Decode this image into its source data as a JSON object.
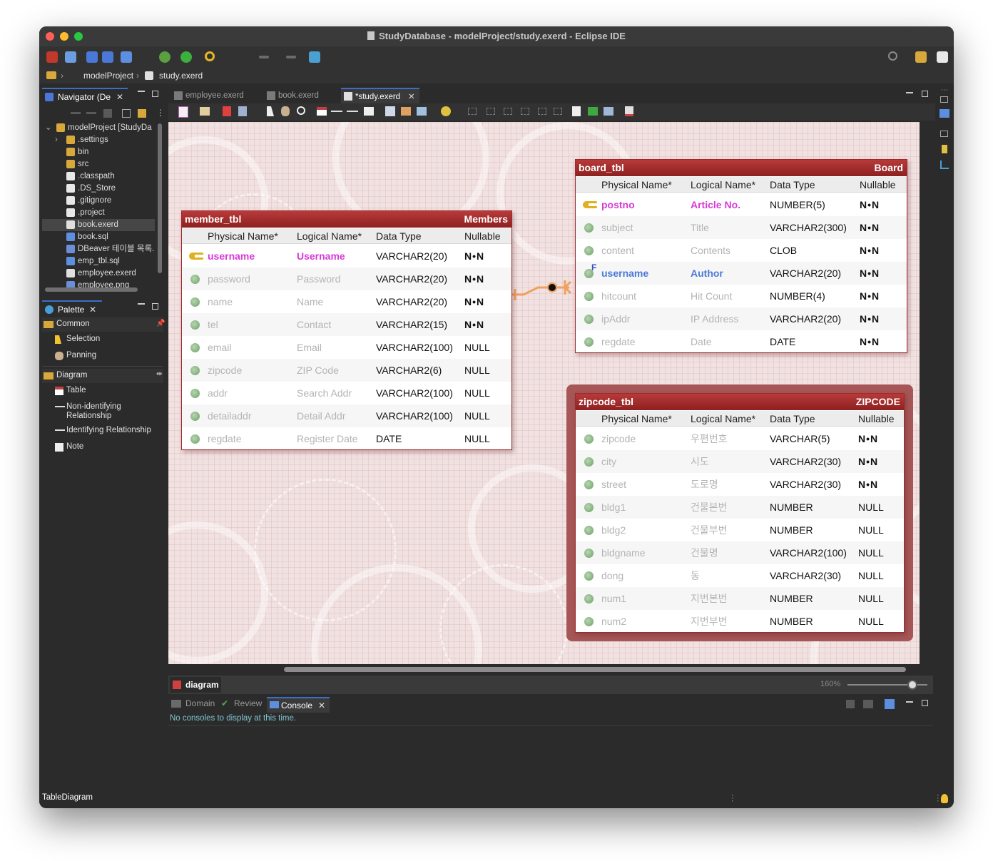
{
  "window": {
    "title": "StudyDatabase - modelProject/study.exerd - Eclipse IDE"
  },
  "breadcrumb": {
    "project": "modelProject",
    "file": "study.exerd"
  },
  "navigator": {
    "tab_label": "Navigator (De",
    "items": [
      {
        "label": "modelProject [StudyDa",
        "kind": "project"
      },
      {
        "label": ".settings",
        "kind": "folder"
      },
      {
        "label": "bin",
        "kind": "folder"
      },
      {
        "label": "src",
        "kind": "folder"
      },
      {
        "label": ".classpath",
        "kind": "file"
      },
      {
        "label": ".DS_Store",
        "kind": "file"
      },
      {
        "label": ".gitignore",
        "kind": "file"
      },
      {
        "label": ".project",
        "kind": "file"
      },
      {
        "label": "book.exerd",
        "kind": "exerd"
      },
      {
        "label": "book.sql",
        "kind": "sql"
      },
      {
        "label": "DBeaver 테이블 목록.p",
        "kind": "web"
      },
      {
        "label": "emp_tbl.sql",
        "kind": "sql"
      },
      {
        "label": "employee.exerd",
        "kind": "exerd"
      },
      {
        "label": "employee.png",
        "kind": "web"
      }
    ]
  },
  "palette": {
    "tab_label": "Palette",
    "common_label": "Common",
    "selection_label": "Selection",
    "panning_label": "Panning",
    "diagram_label": "Diagram",
    "table_label": "Table",
    "nonident_label_1": "Non-identifying",
    "nonident_label_2": "Relationship",
    "ident_label": "Identifying Relationship",
    "note_label": "Note"
  },
  "editor_tabs": [
    {
      "label": "employee.exerd"
    },
    {
      "label": "book.exerd"
    },
    {
      "label": "*study.exerd"
    }
  ],
  "column_headers": {
    "physical": "Physical Name*",
    "logical": "Logical Name*",
    "type": "Data Type",
    "nullable": "Nullable"
  },
  "tables": {
    "member": {
      "physical": "member_tbl",
      "logical": "Members",
      "rows": [
        {
          "p": "username",
          "l": "Username",
          "t": "VARCHAR2(20)",
          "n": "N•N"
        },
        {
          "p": "password",
          "l": "Password",
          "t": "VARCHAR2(20)",
          "n": "N•N"
        },
        {
          "p": "name",
          "l": "Name",
          "t": "VARCHAR2(20)",
          "n": "N•N"
        },
        {
          "p": "tel",
          "l": "Contact",
          "t": "VARCHAR2(15)",
          "n": "N•N"
        },
        {
          "p": "email",
          "l": "Email",
          "t": "VARCHAR2(100)",
          "n": "NULL"
        },
        {
          "p": "zipcode",
          "l": "ZIP Code",
          "t": "VARCHAR2(6)",
          "n": "NULL"
        },
        {
          "p": "addr",
          "l": "Search Addr",
          "t": "VARCHAR2(100)",
          "n": "NULL"
        },
        {
          "p": "detailaddr",
          "l": "Detail Addr",
          "t": "VARCHAR2(100)",
          "n": "NULL"
        },
        {
          "p": "regdate",
          "l": "Register Date",
          "t": "DATE",
          "n": "NULL"
        }
      ]
    },
    "board": {
      "physical": "board_tbl",
      "logical": "Board",
      "rows": [
        {
          "p": "postno",
          "l": "Article No.",
          "t": "NUMBER(5)",
          "n": "N•N"
        },
        {
          "p": "subject",
          "l": "Title",
          "t": "VARCHAR2(300)",
          "n": "N•N"
        },
        {
          "p": "content",
          "l": "Contents",
          "t": "CLOB",
          "n": "N•N"
        },
        {
          "p": "username",
          "l": "Author",
          "t": "VARCHAR2(20)",
          "n": "N•N"
        },
        {
          "p": "hitcount",
          "l": "Hit Count",
          "t": "NUMBER(4)",
          "n": "N•N"
        },
        {
          "p": "ipAddr",
          "l": "IP Address",
          "t": "VARCHAR2(20)",
          "n": "N•N"
        },
        {
          "p": "regdate",
          "l": "Date",
          "t": "DATE",
          "n": "N•N"
        }
      ]
    },
    "zipcode": {
      "physical": "zipcode_tbl",
      "logical": "ZIPCODE",
      "rows": [
        {
          "p": "zipcode",
          "l": "우편번호",
          "t": "VARCHAR(5)",
          "n": "N•N"
        },
        {
          "p": "city",
          "l": "시도",
          "t": "VARCHAR2(30)",
          "n": "N•N"
        },
        {
          "p": "street",
          "l": "도로명",
          "t": "VARCHAR2(30)",
          "n": "N•N"
        },
        {
          "p": "bldg1",
          "l": "건물본번",
          "t": "NUMBER",
          "n": "NULL"
        },
        {
          "p": "bldg2",
          "l": "건물부번",
          "t": "NUMBER",
          "n": "NULL"
        },
        {
          "p": "bldgname",
          "l": "건물명",
          "t": "VARCHAR2(100)",
          "n": "NULL"
        },
        {
          "p": "dong",
          "l": "동",
          "t": "VARCHAR2(30)",
          "n": "NULL"
        },
        {
          "p": "num1",
          "l": "지번본번",
          "t": "NUMBER",
          "n": "NULL"
        },
        {
          "p": "num2",
          "l": "지번부번",
          "t": "NUMBER",
          "n": "NULL"
        }
      ]
    }
  },
  "diagram_tab": {
    "label": "diagram",
    "zoom": "160%"
  },
  "bottom_tabs": [
    {
      "label": "Domain"
    },
    {
      "label": "Review"
    },
    {
      "label": "Console"
    }
  ],
  "console": {
    "message": "No consoles to display at this time."
  },
  "status": {
    "text": "TableDiagram"
  },
  "colors": {
    "table_header": "#a12d2d",
    "canvas": "#f2e1e1",
    "pk": "#d63ad6",
    "fk": "#4a7ad8"
  }
}
